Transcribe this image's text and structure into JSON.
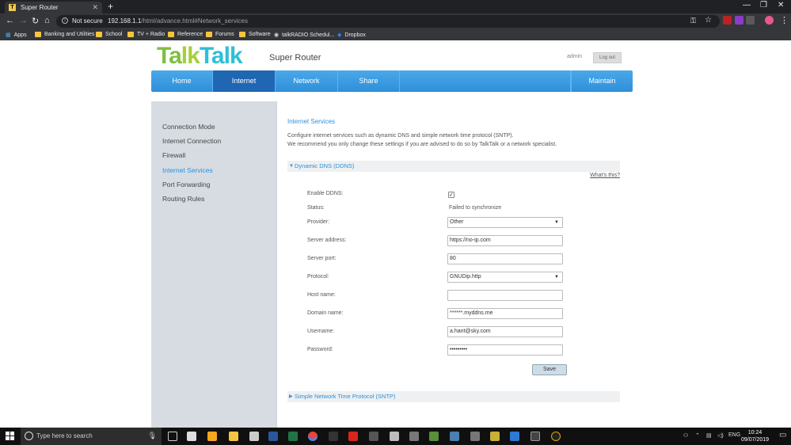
{
  "browser": {
    "tab_title": "Super Router",
    "tab_icon_letter": "T",
    "new_tab": "+",
    "security": "Not secure",
    "url_host": "192.168.1.1",
    "url_path": "/html/advance.html#Network_services",
    "bookmarks": [
      "Apps",
      "Banking and Utilities",
      "School",
      "TV + Radio",
      "Reference",
      "Forums",
      "Software",
      "talkRADIO Schedul...",
      "Dropbox"
    ]
  },
  "header": {
    "logo_part1": "Ta",
    "logo_part2": "lk",
    "logo_part3": "Talk",
    "product": "Super Router",
    "user": "admin",
    "logout": "Log out"
  },
  "menu": [
    "Home",
    "Internet",
    "Network",
    "Share",
    "Maintain"
  ],
  "sidebar": [
    "Connection Mode",
    "Internet Connection",
    "Firewall",
    "Internet Services",
    "Port Forwarding",
    "Routing Rules"
  ],
  "panel": {
    "title": "Internet Services",
    "desc1": "Configure internet services such as dynamic DNS and simple network time protocol (SNTP).",
    "desc2": "We recommend you only change these settings if you are advised to do so by TalkTalk or a network specialist.",
    "ddns_section": "Dynamic DNS (DDNS)",
    "whats_this": "What's this?",
    "sntp_section": "Simple Network Time Protocol (SNTP)",
    "save": "Save"
  },
  "form": {
    "enable_label": "Enable DDNS:",
    "enable_checked": true,
    "status_label": "Status:",
    "status_value": "Failed to synchronize",
    "provider_label": "Provider:",
    "provider_value": "Other",
    "server_address_label": "Server address:",
    "server_address_value": "https://no-ip.com",
    "server_port_label": "Server port:",
    "server_port_value": "80",
    "protocol_label": "Protocol:",
    "protocol_value": "GNUDip.http",
    "host_label": "Host name:",
    "host_value": "",
    "domain_label": "Domain name:",
    "domain_value": "******.myddns.me",
    "username_label": "Username:",
    "username_value": "a.hant@sky.com",
    "password_label": "Password:",
    "password_value": "•••••••••"
  },
  "taskbar": {
    "search_placeholder": "Type here to search",
    "lang": "ENG",
    "time": "10:24",
    "date": "09/07/2019"
  }
}
